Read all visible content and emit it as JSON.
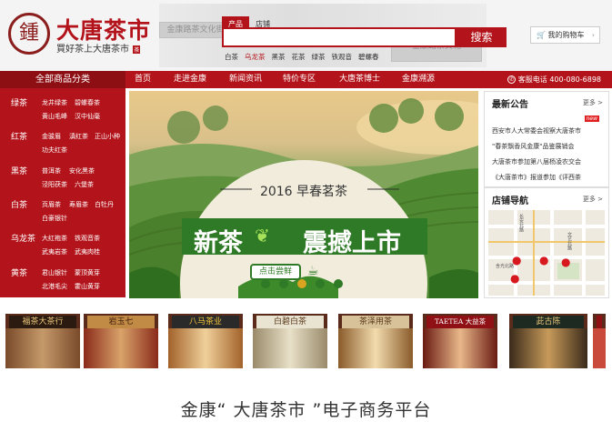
{
  "header": {
    "logo_glyph": "鍾",
    "logo_title": "大唐茶市",
    "logo_slogan": "買好茶上大唐茶市",
    "logo_badge": "茶",
    "bg_signs": [
      "金康路茶文化街",
      "金康路茶文化"
    ],
    "search_tabs": [
      "产品",
      "店铺"
    ],
    "search_button": "搜索",
    "hot_words": [
      "白茶",
      "乌龙茶",
      "黑茶",
      "花茶",
      "绿茶",
      "铁观音",
      "碧螺春"
    ],
    "cart_label": "我的购物车",
    "cart_arrow": "›"
  },
  "nav": {
    "all_categories": "全部商品分类",
    "items": [
      "首页",
      "走进金康",
      "新闻资讯",
      "特价专区",
      "大唐茶博士",
      "金康溯源"
    ],
    "hotline": "客服电话 400-080-6898"
  },
  "sidebar": {
    "categories": [
      {
        "name": "绿茶",
        "subs": [
          "龙井绿茶",
          "碧螺春茶",
          "黄山毛峰",
          "汉中仙毫"
        ]
      },
      {
        "name": "红茶",
        "subs": [
          "金骏眉",
          "滇红茶",
          "正山小种",
          "功夫红茶"
        ]
      },
      {
        "name": "黑茶",
        "subs": [
          "普洱茶",
          "安化黑茶",
          "泾阳茯茶",
          "六堡茶"
        ]
      },
      {
        "name": "白茶",
        "subs": [
          "页眉茶",
          "寿眉茶",
          "白牡丹",
          "白豪银针"
        ]
      },
      {
        "name": "乌龙茶",
        "subs": [
          "大红袍茶",
          "铁观音茶",
          "武夷岩茶",
          "武夷肉桂"
        ]
      },
      {
        "name": "黄茶",
        "subs": [
          "君山银针",
          "蒙顶黄芽",
          "北港毛尖",
          "霍山黄芽"
        ]
      }
    ]
  },
  "banner": {
    "year_title": "2016 早春茗茶",
    "slogan_left": "新茶",
    "slogan_right": "震撼上市",
    "cta": "点击尝鲜"
  },
  "news": {
    "title": "最新公告",
    "more": "更多 >",
    "new_badge": "new",
    "items": [
      "西安市人大常委会视察大唐茶市",
      "\"春茶飘香风金康\"品鉴展销会",
      "大唐茶市参加第八届杨凌农交会",
      "《大唐茶市》报道参加《评西茶"
    ]
  },
  "store_nav": {
    "title": "店铺导航",
    "more": "更多 >",
    "map_labels": [
      "长安北路",
      "文艺北路",
      "含光北路"
    ]
  },
  "shops": [
    {
      "sign": "福茶大茶行"
    },
    {
      "sign": "岩玉七"
    },
    {
      "sign": "八马茶业"
    },
    {
      "sign": "白碧白茶"
    },
    {
      "sign": "茶泽用茶"
    },
    {
      "sign": "TAETEA 大益茶"
    },
    {
      "sign": "茈古陈"
    },
    {
      "sign": ""
    }
  ],
  "caption": "金康“ 大唐茶市 ”电子商务平台"
}
